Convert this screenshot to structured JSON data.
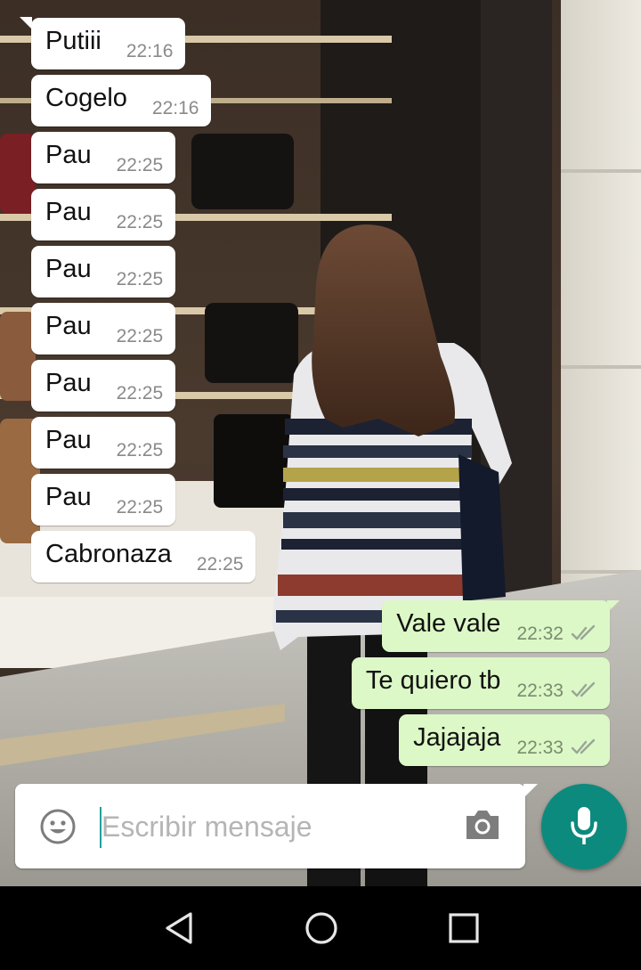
{
  "messages": [
    {
      "direction": "in",
      "text": "Putiii",
      "time": "22:16"
    },
    {
      "direction": "in",
      "text": "Cogelo",
      "time": "22:16"
    },
    {
      "direction": "in",
      "text": "Pau",
      "time": "22:25"
    },
    {
      "direction": "in",
      "text": "Pau",
      "time": "22:25"
    },
    {
      "direction": "in",
      "text": "Pau",
      "time": "22:25"
    },
    {
      "direction": "in",
      "text": "Pau",
      "time": "22:25"
    },
    {
      "direction": "in",
      "text": "Pau",
      "time": "22:25"
    },
    {
      "direction": "in",
      "text": "Pau",
      "time": "22:25"
    },
    {
      "direction": "in",
      "text": "Pau",
      "time": "22:25"
    },
    {
      "direction": "in",
      "text": "Cabronaza",
      "time": "22:25"
    },
    {
      "direction": "out",
      "text": "Vale vale",
      "time": "22:32",
      "status": "double-check-read"
    },
    {
      "direction": "out",
      "text": "Te quiero tb",
      "time": "22:33",
      "status": "double-check-read"
    },
    {
      "direction": "out",
      "text": "Jajajaja",
      "time": "22:33",
      "status": "double-check-read"
    }
  ],
  "input": {
    "placeholder": "Escribir mensaje",
    "value": ""
  },
  "icons": {
    "emoji": "smiley-icon",
    "camera": "camera-icon",
    "mic": "microphone-icon",
    "nav_back": "triangle-back-icon",
    "nav_home": "circle-home-icon",
    "nav_recents": "square-recents-icon"
  },
  "colors": {
    "incoming_bubble": "#ffffff",
    "outgoing_bubble": "#dcf8c6",
    "accent": "#0c8a7d",
    "ticks": "#9aa596",
    "nav_bar": "#000000"
  }
}
